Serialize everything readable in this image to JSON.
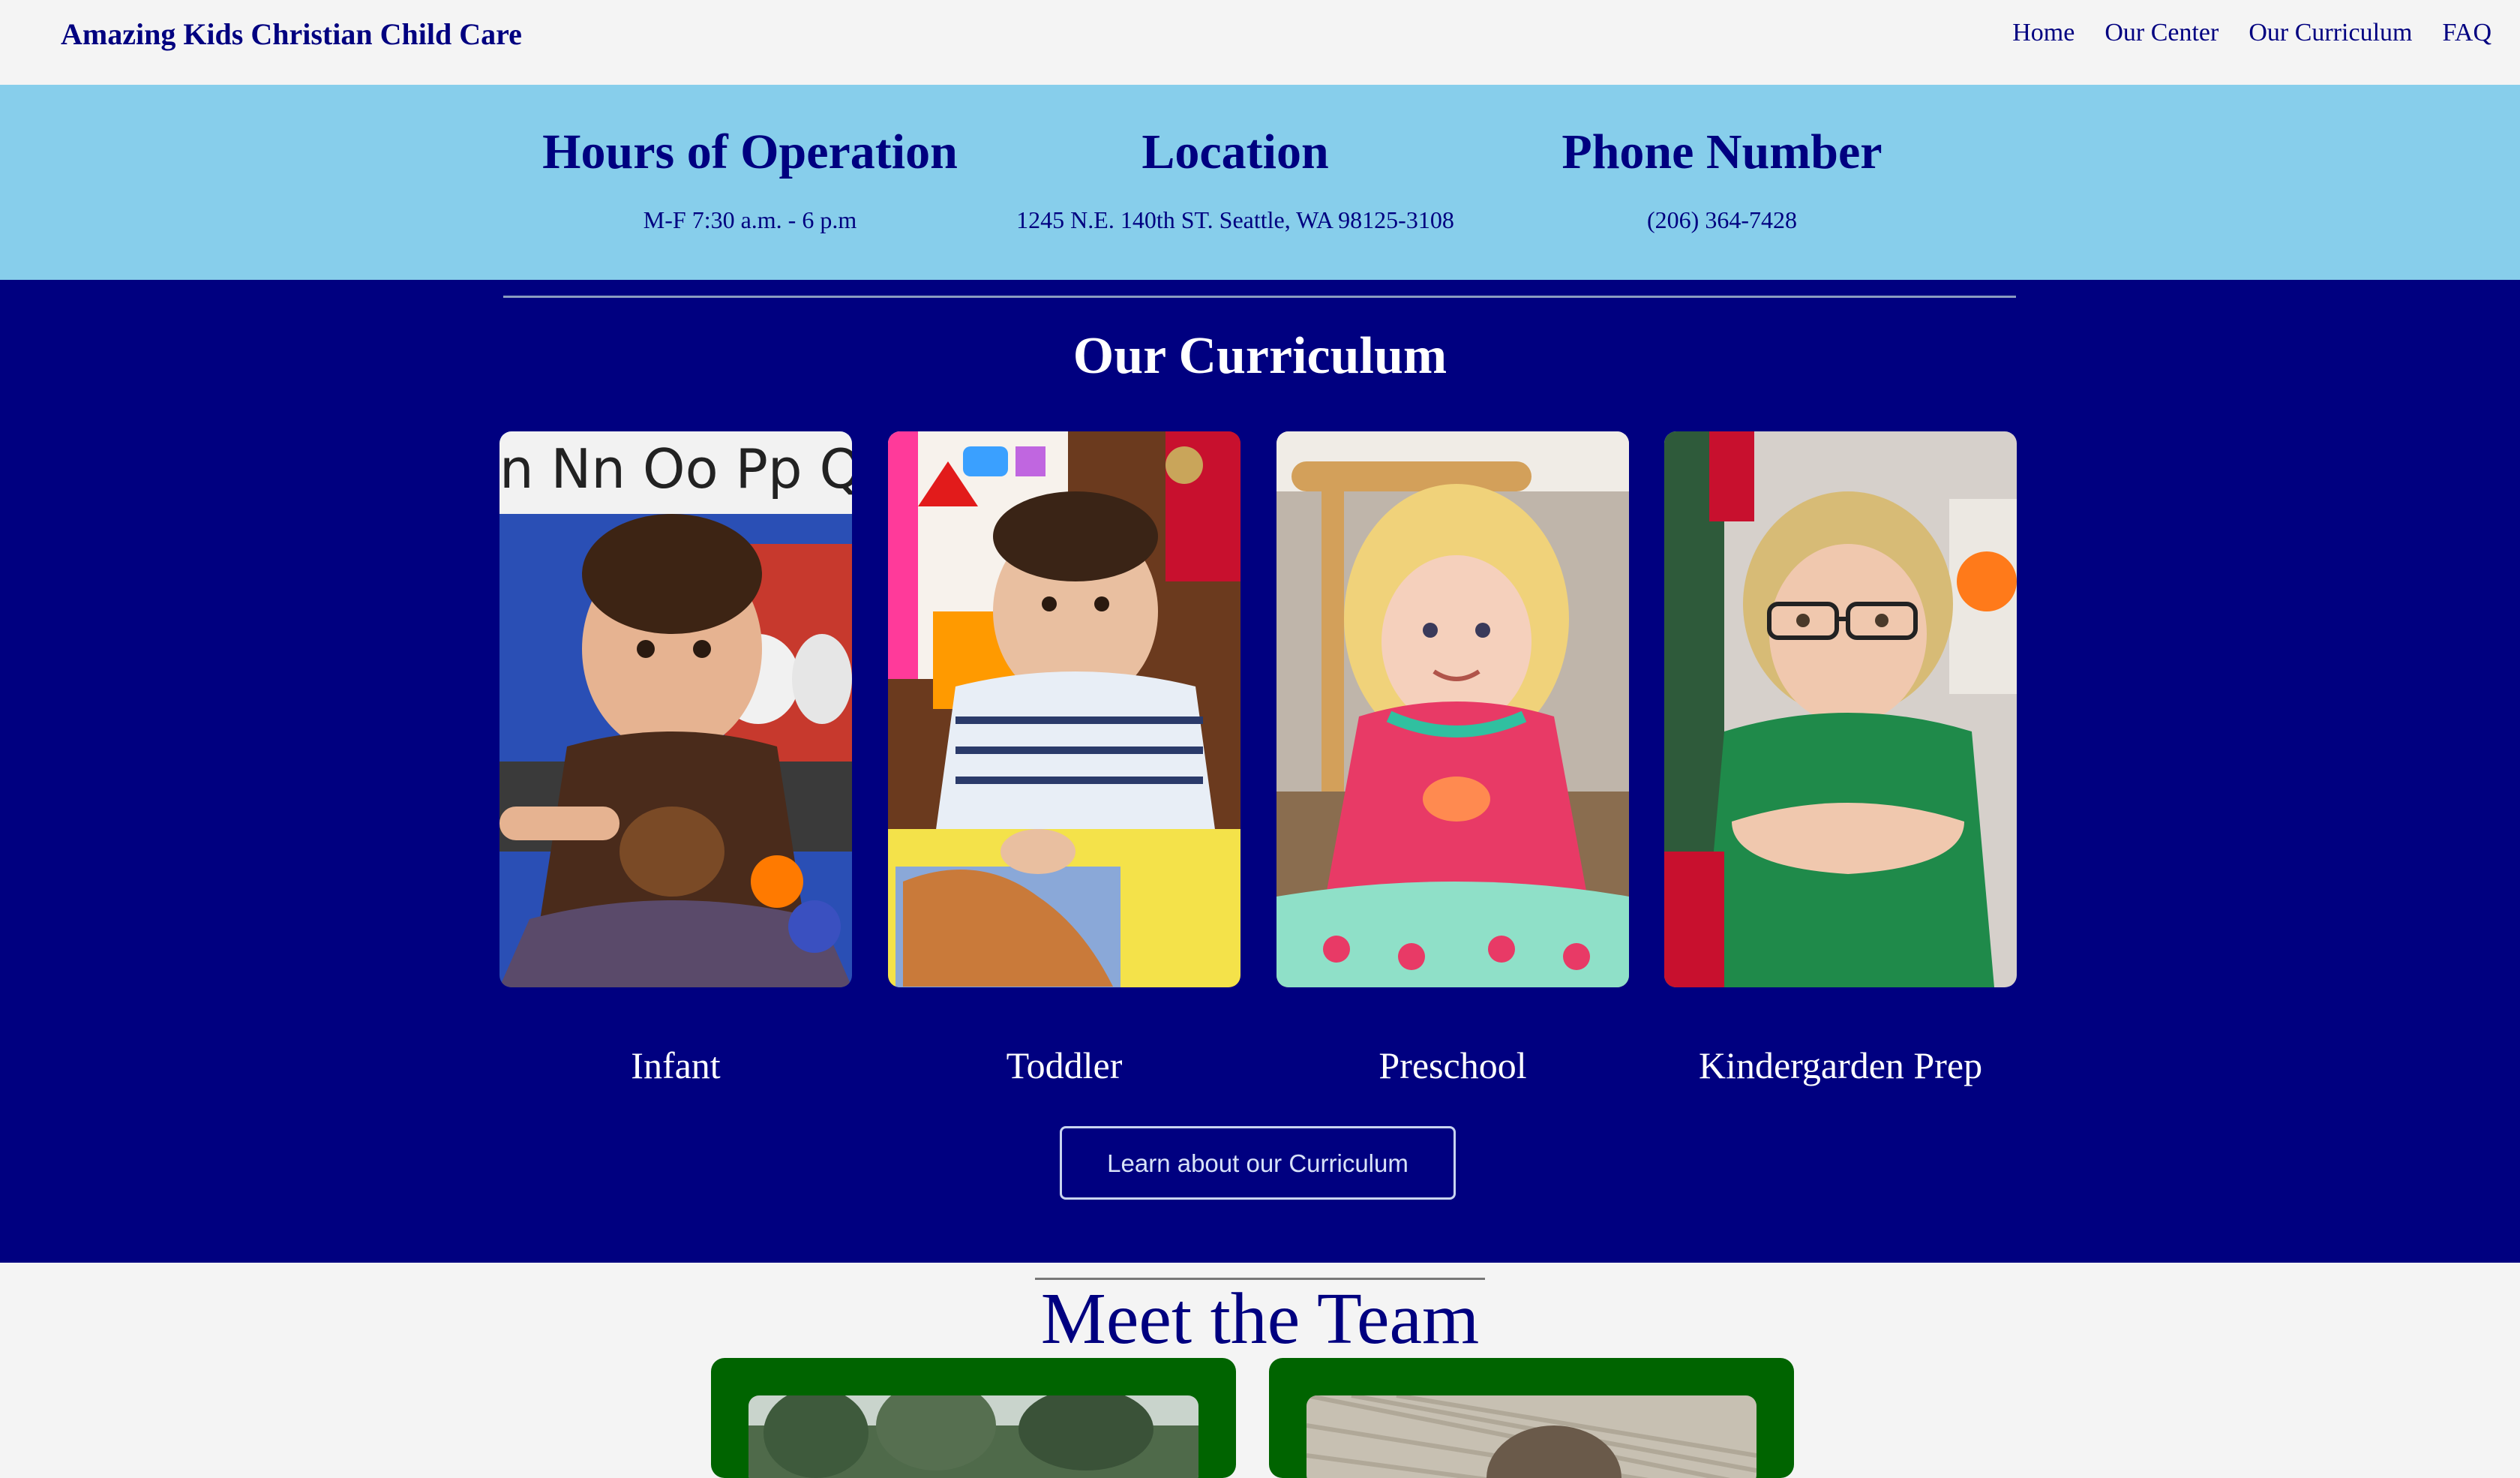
{
  "navbar": {
    "brand": "Amazing Kids Christian Child Care",
    "links": [
      "Home",
      "Our Center",
      "Our Curriculum",
      "FAQ"
    ]
  },
  "info": {
    "hours": {
      "title": "Hours of Operation",
      "value": "M-F 7:30 a.m. - 6 p.m"
    },
    "location": {
      "title": "Location",
      "value": "1245 N.E. 140th ST. Seattle, WA 98125-3108"
    },
    "phone": {
      "title": "Phone Number",
      "value": "(206) 364-7428"
    }
  },
  "curriculum": {
    "title": "Our Curriculum",
    "programs": [
      "Infant",
      "Toddler",
      "Preschool",
      "Kindergarden Prep"
    ],
    "button_label": "Learn about our Curriculum"
  },
  "team": {
    "title": "Meet the Team"
  },
  "colors": {
    "navy": "#000080",
    "sky": "#87ceeb",
    "page_bg": "#f4f4f4",
    "team_card": "#006400"
  }
}
